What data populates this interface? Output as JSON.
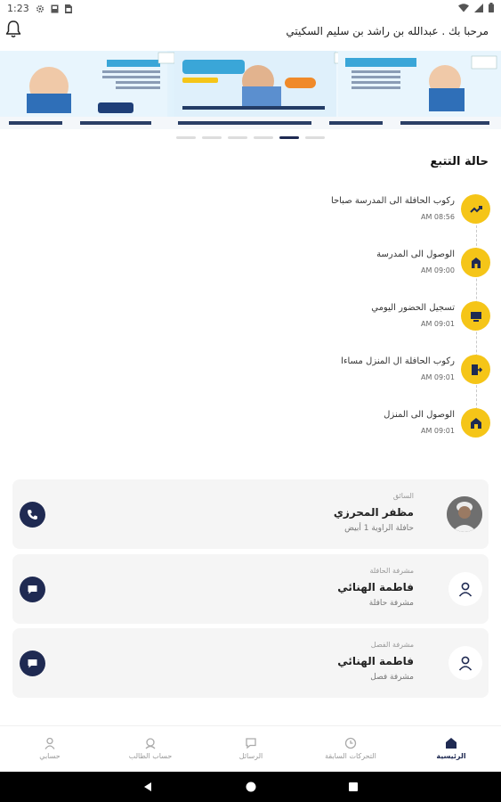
{
  "status_bar": {
    "time": "1:23",
    "left_icons": [
      "gear-icon",
      "photo-icon",
      "sim-icon"
    ],
    "right_icons": [
      "wifi-icon",
      "signal-icon",
      "battery-icon"
    ]
  },
  "header": {
    "greeting": "مرحبا بك . عبدالله بن راشد بن سليم السكيتي"
  },
  "banner": {
    "slides": 3,
    "active_indicator": 5,
    "indicator_count": 6
  },
  "tracking": {
    "title": "حالة التتبع",
    "events": [
      {
        "title": "ركوب الحافلة الى المدرسة صباحا",
        "time": "AM 08:56",
        "icon": "trend-up-icon"
      },
      {
        "title": "الوصول الى المدرسة",
        "time": "AM 09:00",
        "icon": "school-icon"
      },
      {
        "title": "تسجيل الحضور اليومي",
        "time": "AM 09:01",
        "icon": "board-icon"
      },
      {
        "title": "ركوب الحافلة ال المنزل مساءا",
        "time": "AM 09:01",
        "icon": "door-icon"
      },
      {
        "title": "الوصول الى المنزل",
        "time": "AM 09:01",
        "icon": "home-icon"
      }
    ]
  },
  "contacts": [
    {
      "role": "السائق",
      "name": "مظفر المحرزي",
      "sub": "حافلة الراوية 1 أبيض",
      "avatar": "photo",
      "action": "phone-icon"
    },
    {
      "role": "مشرفة الحافلة",
      "name": "فاطمة الهنائي",
      "sub": "مشرفة حافلة",
      "avatar": "user-icon",
      "action": "chat-icon"
    },
    {
      "role": "مشرفة الفصل",
      "name": "فاطمة الهنائي",
      "sub": "مشرفة فصل",
      "avatar": "user-icon",
      "action": "chat-icon"
    }
  ],
  "bottom_nav": {
    "items": [
      {
        "label": "الرئيسية",
        "icon": "home-icon",
        "active": true
      },
      {
        "label": "التحركات السابقة",
        "icon": "clock-icon",
        "active": false
      },
      {
        "label": "الرسائل",
        "icon": "chat-icon",
        "active": false
      },
      {
        "label": "حساب الطالب",
        "icon": "student-icon",
        "active": false
      },
      {
        "label": "حسابي",
        "icon": "user-icon",
        "active": false
      }
    ]
  },
  "colors": {
    "accent": "#f5c518",
    "navy": "#1f2a52",
    "card": "#f5f5f5"
  }
}
